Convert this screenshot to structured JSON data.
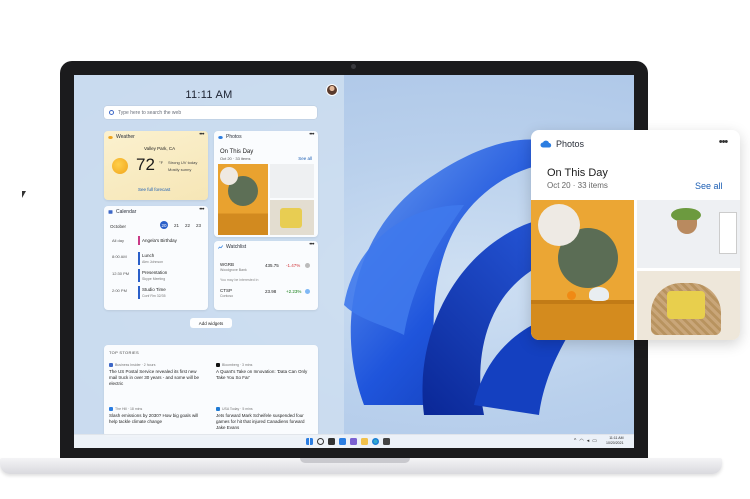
{
  "clock": "11:11 AM",
  "search": {
    "placeholder": "Type here to search the web"
  },
  "weather": {
    "title": "Weather",
    "location": "Valley Park, CA",
    "temp": "72",
    "unit": "°F",
    "detail1": "Strong UV today",
    "detail2": "Mostly sunny",
    "link": "See full forecast"
  },
  "photos_small": {
    "title": "Photos",
    "heading": "On This Day",
    "sub": "Oct 20 · 33 items",
    "link": "See all"
  },
  "calendar": {
    "title": "Calendar",
    "month": "October",
    "days": [
      "20",
      "21",
      "22",
      "23"
    ],
    "today_index": 0,
    "events": [
      {
        "time": "All day",
        "title": "Angela's Birthday",
        "sub": ""
      },
      {
        "time": "8:00 AM",
        "title": "Lunch",
        "sub": "Alex Johnson"
      },
      {
        "time": "12:30 PM",
        "title": "Presentation",
        "sub": "Skype Meeting"
      },
      {
        "time": "2:00 PM",
        "title": "Studio Time",
        "sub": "Conf Rm 32/35"
      }
    ]
  },
  "watchlist": {
    "title": "Watchlist",
    "stocks": [
      {
        "symbol": "WGRB",
        "name": "Woodgrove Bank",
        "price": "435.75",
        "change": "-1.47%",
        "color": "#d13438"
      },
      {
        "symbol": "CTSP",
        "name": "Contoso",
        "price": "23.98",
        "change": "+2.23%",
        "color": "#107c10"
      }
    ],
    "interest": "You may be interested in"
  },
  "add_widgets": "Add widgets",
  "stories": {
    "header": "TOP STORIES",
    "items": [
      {
        "source": "Business Insider · 2 hours",
        "title": "The US Postal Service revealed its first new mail truck in over 30 years - and some will be electric"
      },
      {
        "source": "Bloomberg · 3 mins",
        "title": "A Quant's Take on Innovation: 'Data Can Only Take You So Far'"
      },
      {
        "source": "The Hill · 18 mins",
        "title": "Slash emissions by 2030? How big goals will help tackle climate change"
      },
      {
        "source": "USA Today · 5 mins",
        "title": "Jets forward Mark Scheifele suspended four games for hit that injured Canadiens forward Jake Evans"
      }
    ]
  },
  "taskbar": {
    "time": "11:11 AM",
    "date": "10/20/2021"
  },
  "photos_large": {
    "title": "Photos",
    "heading": "On This Day",
    "sub": "Oct 20 · 33 items",
    "link": "See all",
    "more": "•••"
  },
  "colors": {
    "accent": "#1d5fb4",
    "bloom": "#1a4fd6"
  }
}
